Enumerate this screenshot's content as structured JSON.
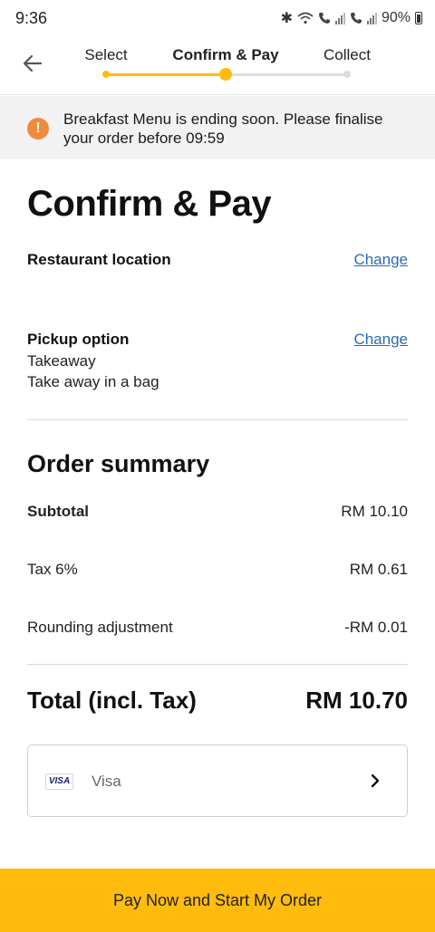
{
  "status_bar": {
    "time": "9:36",
    "battery": "90%"
  },
  "progress": {
    "steps": [
      {
        "label": "Select",
        "state": "done"
      },
      {
        "label": "Confirm & Pay",
        "state": "current"
      },
      {
        "label": "Collect",
        "state": "todo"
      }
    ],
    "accent_color": "#ffbc0d"
  },
  "banner": {
    "icon": "alert-icon",
    "text": "Breakfast Menu is ending soon. Please finalise your order before 09:59"
  },
  "page": {
    "title": "Confirm & Pay"
  },
  "restaurant": {
    "label": "Restaurant location",
    "change": "Change"
  },
  "pickup": {
    "label": "Pickup option",
    "change": "Change",
    "option": "Takeaway",
    "detail": "Take away in a bag"
  },
  "summary": {
    "title": "Order summary",
    "rows": [
      {
        "label": "Subtotal",
        "value": "RM 10.10"
      },
      {
        "label": "Tax 6%",
        "value": "RM 0.61"
      },
      {
        "label": "Rounding adjustment",
        "value": "-RM 0.01"
      }
    ],
    "total_label": "Total (incl. Tax)",
    "total_value": "RM 10.70"
  },
  "payment": {
    "badge": "VISA",
    "method": "Visa"
  },
  "pay_button": {
    "label": "Pay Now and Start My Order"
  },
  "link_color": "#2a6cb4",
  "alert_color": "#f08a3c"
}
